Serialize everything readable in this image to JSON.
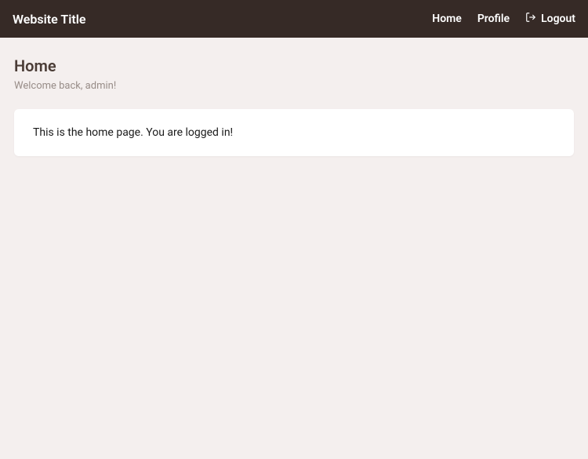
{
  "navbar": {
    "brand": "Website Title",
    "links": {
      "home": "Home",
      "profile": "Profile",
      "logout": "Logout"
    }
  },
  "page": {
    "title": "Home",
    "subtitle": "Welcome back, admin!"
  },
  "card": {
    "text": "This is the home page. You are logged in!"
  }
}
